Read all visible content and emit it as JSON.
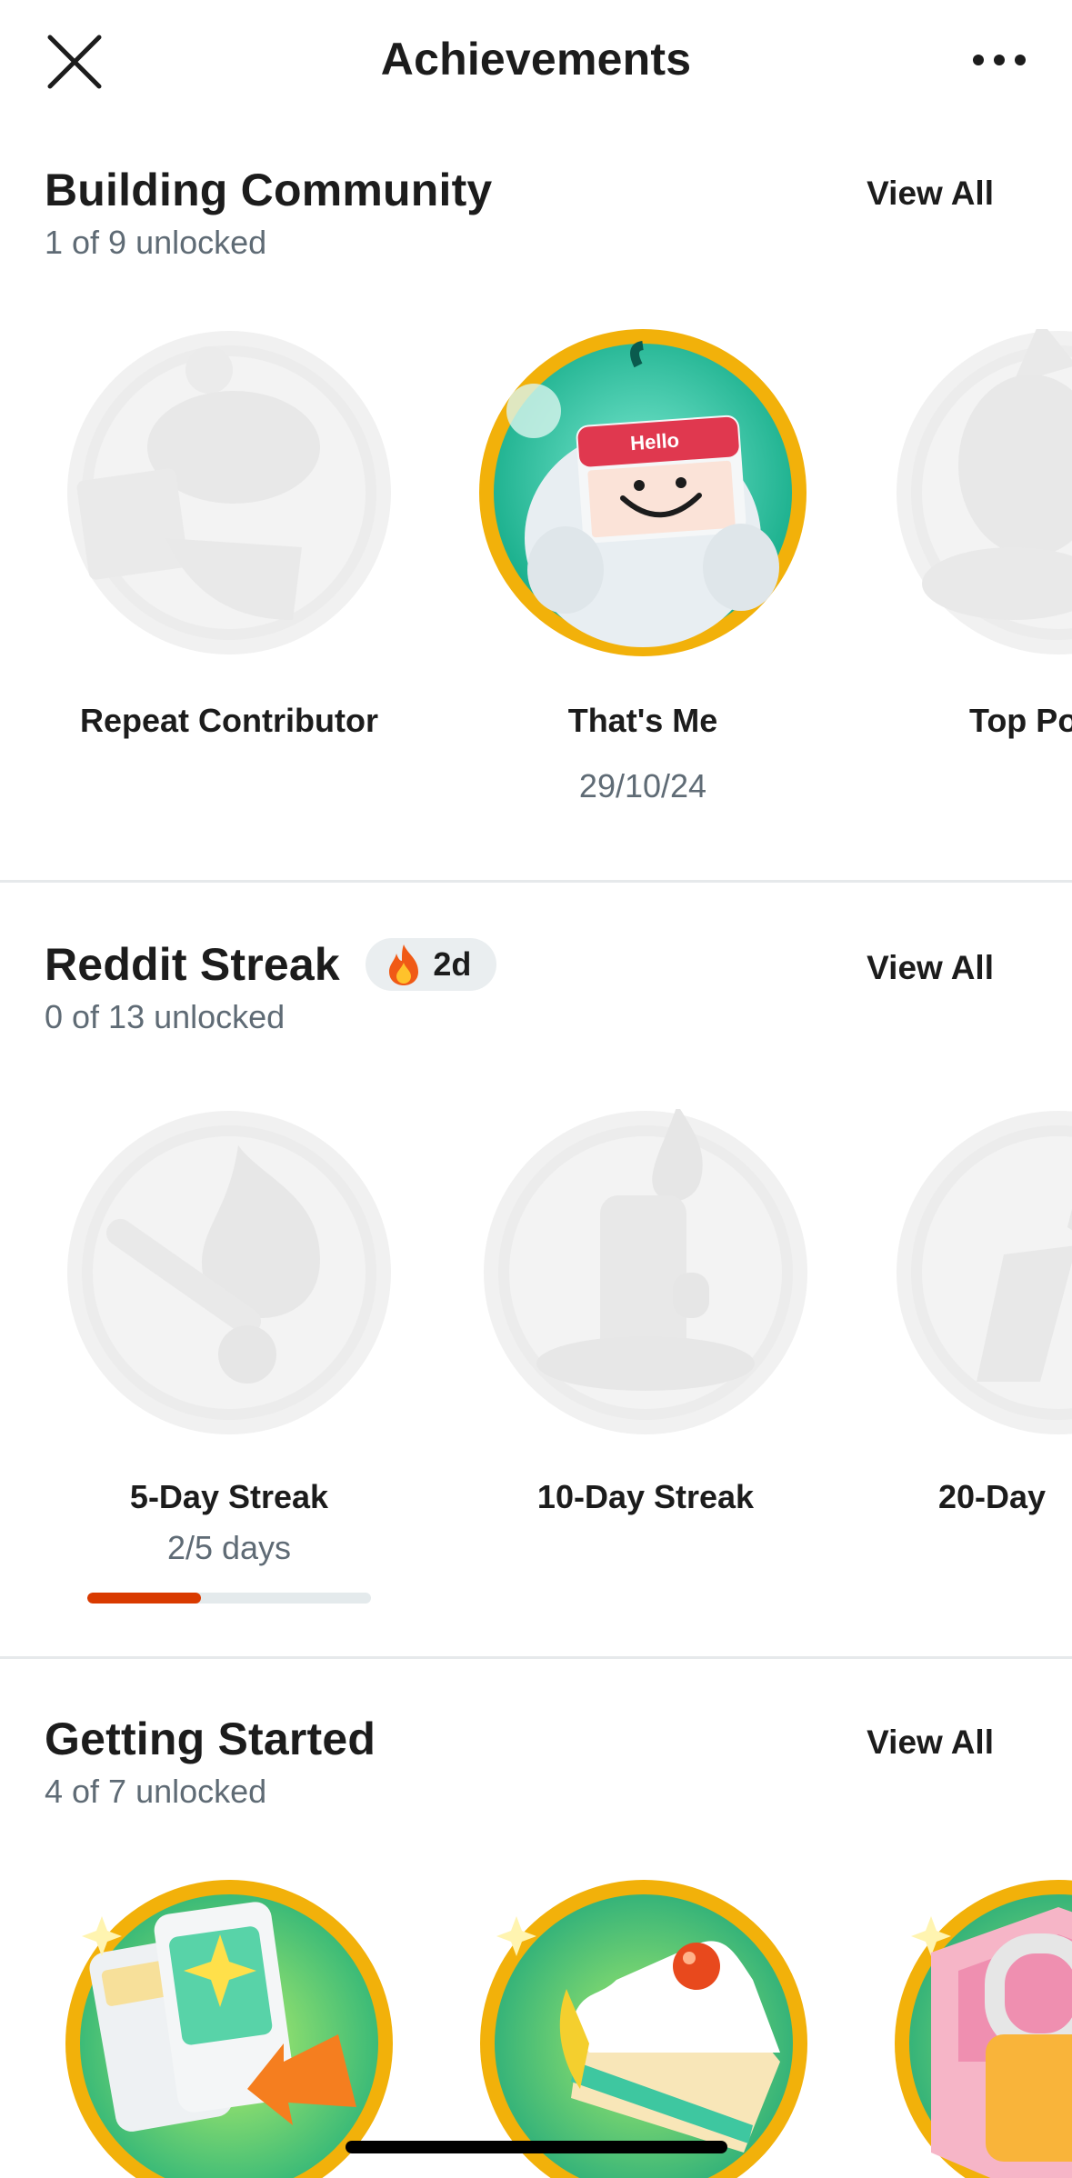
{
  "header": {
    "title": "Achievements",
    "close_icon": "close-icon",
    "more_icon": "more-horizontal-icon"
  },
  "sections": [
    {
      "title": "Building Community",
      "subtitle": "1 of 9 unlocked",
      "view_all": "View All",
      "badges": [
        {
          "label": "Repeat Contributor",
          "meta": "",
          "locked": true,
          "icon": "snoo-sign-icon"
        },
        {
          "label": "That's Me",
          "meta": "29/10/24",
          "locked": false,
          "icon": "snoo-hello-nametag-icon",
          "nametag_text": "Hello"
        },
        {
          "label": "Top Po",
          "meta": "",
          "locked": true,
          "icon": "snoo-trophy-icon"
        }
      ]
    },
    {
      "title": "Reddit Streak",
      "subtitle": "0 of 13 unlocked",
      "view_all": "View All",
      "streak": {
        "icon": "fire-icon",
        "value": "2d"
      },
      "badges": [
        {
          "label": "5-Day Streak",
          "meta": "2/5 days",
          "locked": true,
          "icon": "match-flame-icon",
          "progress": 0.4
        },
        {
          "label": "10-Day Streak",
          "meta": "",
          "locked": true,
          "icon": "candle-flame-icon"
        },
        {
          "label": "20-Day",
          "meta": "",
          "locked": true,
          "icon": "torch-flame-icon"
        }
      ]
    },
    {
      "title": "Getting Started",
      "subtitle": "4 of 7 unlocked",
      "view_all": "View All",
      "badges": [
        {
          "label": "",
          "meta": "",
          "locked": false,
          "icon": "phones-share-icon"
        },
        {
          "label": "",
          "meta": "",
          "locked": false,
          "icon": "cake-slice-icon"
        },
        {
          "label": "",
          "meta": "",
          "locked": false,
          "icon": "shield-lock-icon"
        }
      ]
    }
  ],
  "colors": {
    "accent": "#d93a00",
    "badge_gold": "#f5b50b",
    "badge_teal": "#18b892",
    "locked_gray": "#f0f0f0",
    "subtext": "#5f6b75"
  }
}
